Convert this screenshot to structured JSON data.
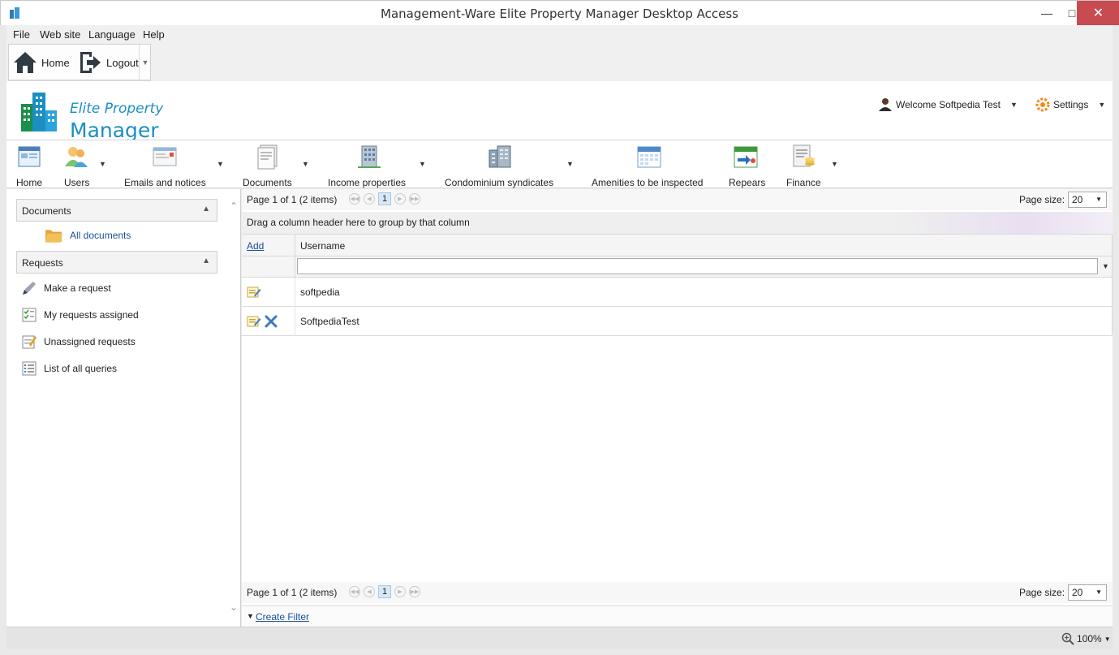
{
  "window": {
    "title": "Management-Ware Elite Property Manager Desktop Access"
  },
  "menu": [
    "File",
    "Web site",
    "Language",
    "Help"
  ],
  "quickbar": {
    "home_label": "Home",
    "logout_label": "Logout"
  },
  "header": {
    "logo_line1": "Elite Property",
    "logo_line2": "Manager",
    "welcome": "Welcome Softpedia Test",
    "settings": "Settings"
  },
  "ribbon": [
    {
      "label": "Home",
      "icon": "home-page-icon"
    },
    {
      "label": "Users",
      "icon": "users-icon"
    },
    {
      "label": "Emails and notices",
      "icon": "email-icon"
    },
    {
      "label": "Documents",
      "icon": "documents-icon"
    },
    {
      "label": "Income properties",
      "icon": "building-icon"
    },
    {
      "label": "Condominium syndicates",
      "icon": "condo-icon"
    },
    {
      "label": "Amenities to be inspected",
      "icon": "calendar-icon"
    },
    {
      "label": "Repears",
      "icon": "repair-icon"
    },
    {
      "label": "Finance",
      "icon": "finance-icon"
    }
  ],
  "sidebar": {
    "documents_header": "Documents",
    "all_documents": "All documents",
    "requests_header": "Requests",
    "requests": [
      {
        "label": "Make a request",
        "icon": "pen-icon"
      },
      {
        "label": "My requests assigned",
        "icon": "checklist-icon"
      },
      {
        "label": "Unassigned requests",
        "icon": "note-icon"
      },
      {
        "label": "List of all queries",
        "icon": "list-icon"
      }
    ]
  },
  "grid": {
    "pager_text": "Page 1 of 1 (2 items)",
    "current_page": "1",
    "page_size_label": "Page size:",
    "page_size_value": "20",
    "group_hint": "Drag a column header here to group by that column",
    "add_label": "Add",
    "column_username": "Username",
    "rows": [
      "softpedia",
      "SoftpediaTest"
    ],
    "create_filter": "Create Filter"
  },
  "status": {
    "zoom": "100%"
  },
  "colors": {
    "accent": "#1b8fc2",
    "close": "#c74b50",
    "link": "#1a4f9c"
  }
}
